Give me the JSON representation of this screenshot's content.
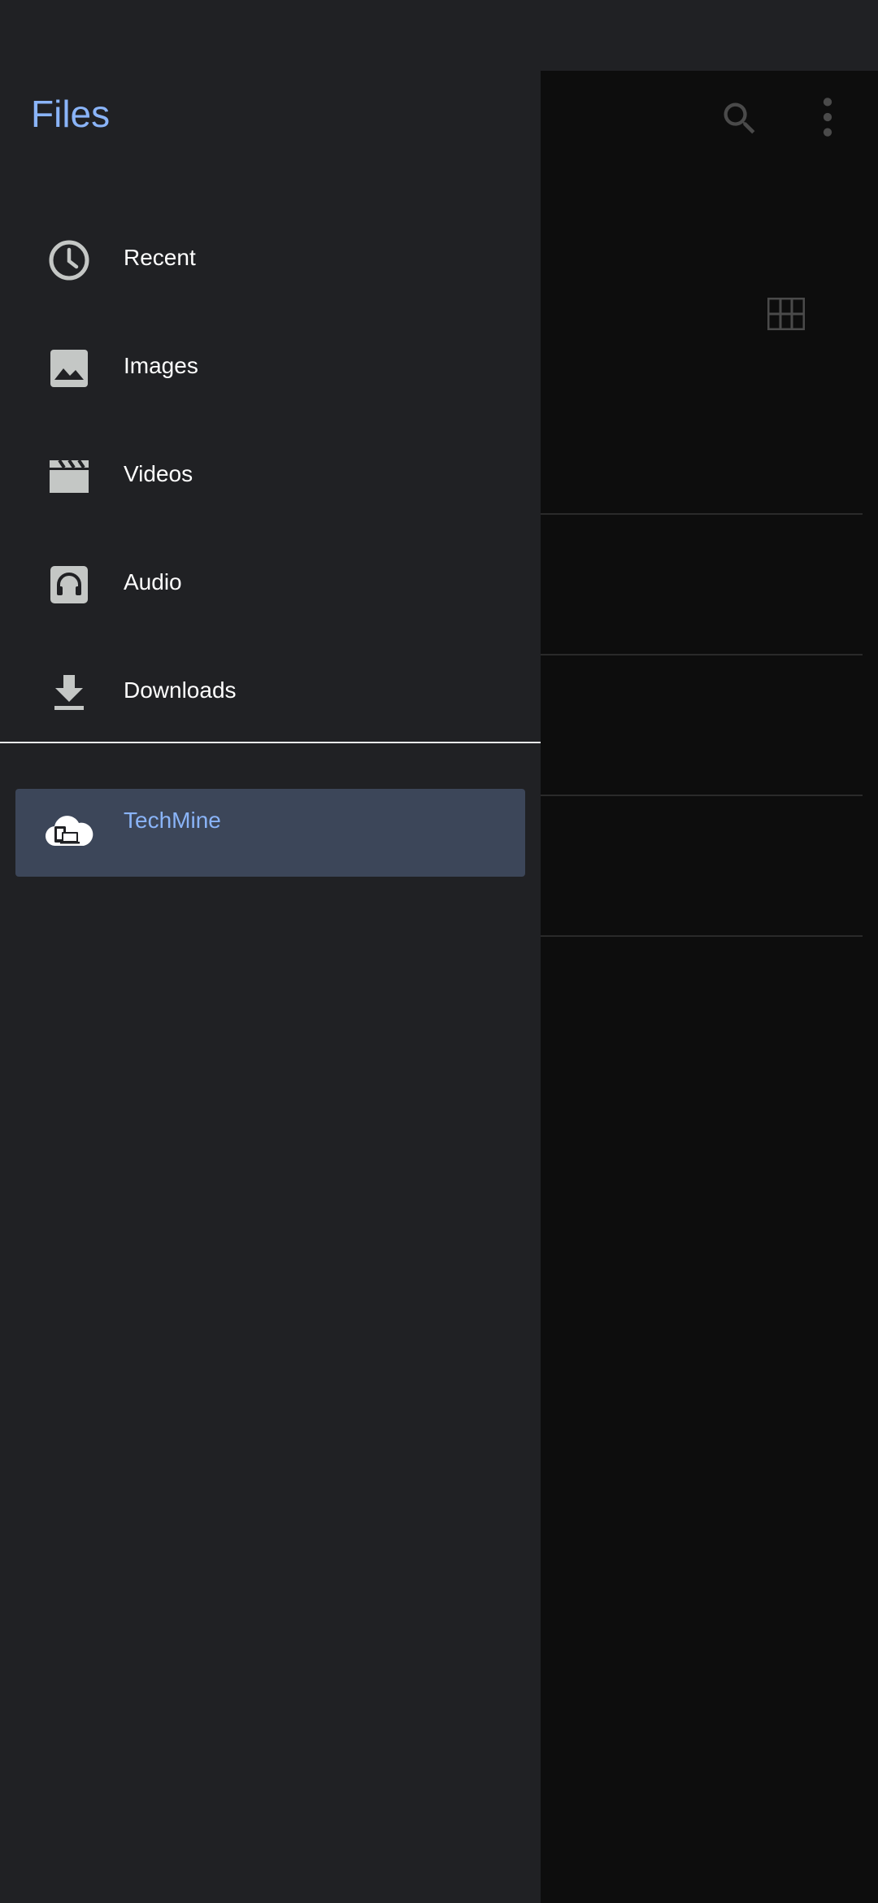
{
  "drawer": {
    "title": "Files",
    "items": [
      {
        "label": "Recent",
        "icon": "clock-icon"
      },
      {
        "label": "Images",
        "icon": "image-icon"
      },
      {
        "label": "Videos",
        "icon": "video-icon"
      },
      {
        "label": "Audio",
        "icon": "headphones-icon"
      },
      {
        "label": "Downloads",
        "icon": "download-icon"
      }
    ],
    "roots": [
      {
        "label": "TechMine",
        "icon": "cloud-device-icon",
        "selected": true
      }
    ]
  },
  "background": {
    "toolbar_icons": [
      "search-icon",
      "more-vert-icon"
    ],
    "view_toggle_icon": "grid-view-icon"
  },
  "colors": {
    "accent": "#8ab4f8",
    "drawer_bg": "#202124",
    "selected_bg": "#3c4659",
    "icon_gray": "#c4c7c5"
  }
}
